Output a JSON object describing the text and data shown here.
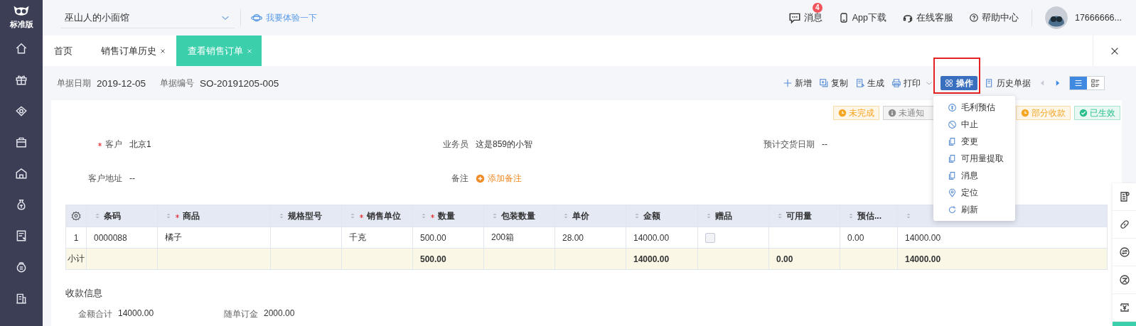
{
  "sidebar": {
    "logo_text": "标准版"
  },
  "topbar": {
    "shop_select": {
      "value": "巫山人的小面馆"
    },
    "trial_link": "我要体验一下",
    "messages": {
      "label": "消息",
      "badge": "4"
    },
    "app_download": "App下载",
    "online_service": "在线客服",
    "help_center": "帮助中心",
    "user": "17666666..."
  },
  "tabs": [
    {
      "label": "首页",
      "selected": false,
      "closable": false
    },
    {
      "label": "销售订单历史",
      "selected": false,
      "closable": true
    },
    {
      "label": "查看销售订单",
      "selected": true,
      "closable": true
    }
  ],
  "toolbar": {
    "doc_date_label": "单据日期",
    "doc_date": "2019-12-05",
    "doc_no_label": "单据编号",
    "doc_no": "SO-20191205-005",
    "actions": [
      {
        "kind": "add",
        "label": "新增"
      },
      {
        "kind": "copy",
        "label": "复制"
      },
      {
        "kind": "generate",
        "label": "生成"
      },
      {
        "kind": "print",
        "label": "打印"
      }
    ],
    "operate_button": {
      "label": "操作",
      "highlighted": true
    },
    "history": "历史单据",
    "view_modes": [
      {
        "kind": "list",
        "selected": true
      },
      {
        "kind": "detail",
        "selected": false
      }
    ]
  },
  "status_tags": [
    {
      "kind": "clock",
      "label": "未完成",
      "color": "#f5a623"
    },
    {
      "kind": "info",
      "label": "未通知",
      "color": "#8c8c8c"
    },
    {
      "kind": "clock",
      "label": "部分收款",
      "color": "#f5a623"
    },
    {
      "kind": "check",
      "label": "已生效",
      "color": "#2bbf8e"
    }
  ],
  "fields": [
    {
      "kind": "text",
      "label": "客户",
      "required": true,
      "value": "北京1"
    },
    {
      "kind": "text",
      "label": "业务员",
      "required": false,
      "value": "这是859的小智"
    },
    {
      "kind": "text",
      "label": "预计交货日期",
      "required": false,
      "value": "--"
    },
    {
      "kind": "text",
      "label": "客户地址",
      "required": false,
      "value": "--"
    },
    {
      "kind": "link",
      "label": "备注",
      "required": false,
      "value": "添加备注"
    }
  ],
  "table": {
    "columns": [
      {
        "kind": "text",
        "label": "条码",
        "required": false
      },
      {
        "kind": "text",
        "label": "商品",
        "required": true
      },
      {
        "kind": "text",
        "label": "规格型号",
        "required": false
      },
      {
        "kind": "text",
        "label": "销售单位",
        "required": true
      },
      {
        "kind": "text",
        "label": "数量",
        "required": true
      },
      {
        "kind": "text",
        "label": "包装数量",
        "required": false
      },
      {
        "kind": "text",
        "label": "单价",
        "required": false
      },
      {
        "kind": "text",
        "label": "金额",
        "required": false
      },
      {
        "kind": "checkbox",
        "label": "赠品",
        "required": false
      },
      {
        "kind": "text",
        "label": "可用量",
        "required": false
      },
      {
        "kind": "text",
        "label": "预估...",
        "required": false
      },
      {
        "kind": "text",
        "required": false
      }
    ],
    "rows": [
      {
        "index": "1",
        "cells": [
          "0000088",
          "橘子",
          null,
          "千克",
          "500.00",
          "200箱",
          "28.00",
          "14000.00",
          false,
          null,
          "0.00",
          "14000.00"
        ]
      }
    ],
    "subtotal": {
      "label": "小计",
      "cells": [
        null,
        null,
        null,
        null,
        "500.00",
        null,
        null,
        "14000.00",
        null,
        "0.00",
        null,
        "14000.00"
      ]
    }
  },
  "payment": {
    "title": "收款信息",
    "fields": [
      {
        "label": "金额合计",
        "value": "14000.00"
      },
      {
        "label": "随单订金",
        "value": "2000.00"
      }
    ]
  },
  "operate_menu": {
    "open": true,
    "items": [
      {
        "kind": "profit",
        "label": "毛利预估"
      },
      {
        "kind": "stop",
        "label": "中止"
      },
      {
        "kind": "doc",
        "label": "变更"
      },
      {
        "kind": "doc",
        "label": "可用量提取"
      },
      {
        "kind": "doc",
        "label": "消息"
      },
      {
        "kind": "pin",
        "label": "定位"
      },
      {
        "kind": "refresh",
        "label": "刷新"
      }
    ]
  }
}
